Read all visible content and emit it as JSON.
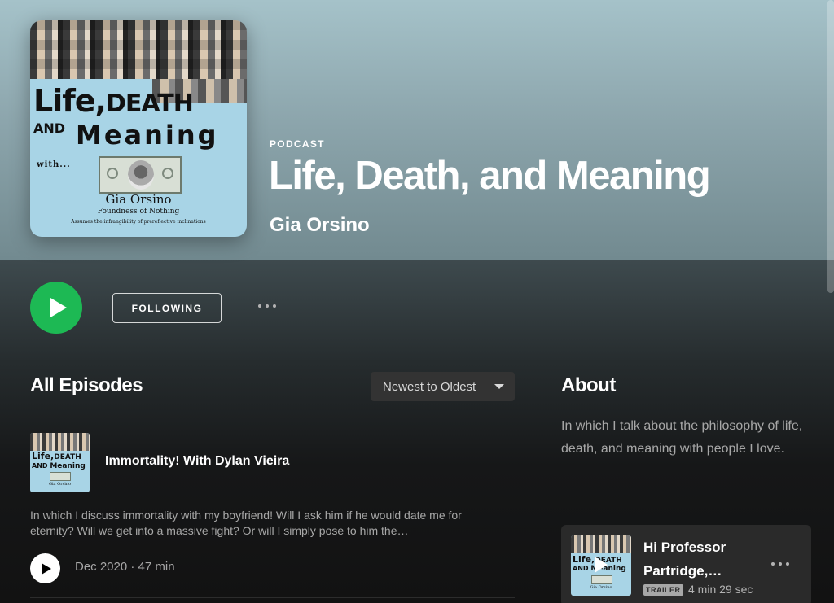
{
  "header": {
    "kind_label": "PODCAST",
    "title": "Life, Death, and Meaning",
    "author": "Gia Orsino"
  },
  "cover": {
    "line1_a": "Life,",
    "line1_b": "DEATH",
    "line2_a": "AND",
    "line2_b": "Meaning",
    "with": "with...",
    "name": "Gia Orsino",
    "subtitle": "Foundness of Nothing",
    "tagline": "Assumes the infrangibility of prereflective inclinations"
  },
  "actions": {
    "follow_label": "FOLLOWING",
    "more_icon": "more-horizontal-icon",
    "play_color": "#1db954"
  },
  "episodes": {
    "heading": "All Episodes",
    "sort_selected": "Newest to Oldest",
    "items": [
      {
        "title": "Immortality! With Dylan Vieira",
        "description": "In which I discuss immortality with my boyfriend! Will I ask him if he would date me for eternity? Will we get into a massive fight? Or will I simply pose to him the…",
        "meta": "Dec 2020 · 47 min"
      }
    ]
  },
  "about": {
    "heading": "About",
    "text": "In which I talk about the philosophy of life, death, and meaning with people I love.",
    "trailer": {
      "title": "Hi Professor Partridge,…",
      "badge": "TRAILER",
      "duration": "4 min 29 sec"
    }
  }
}
